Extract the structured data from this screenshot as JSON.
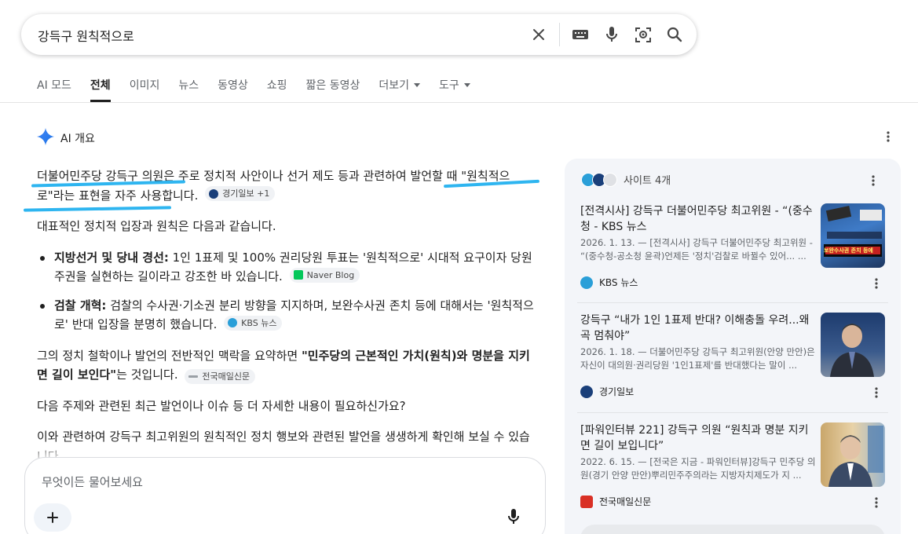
{
  "search": {
    "query": "강득구 원칙적으로"
  },
  "tabs": [
    {
      "label": "AI 모드"
    },
    {
      "label": "전체",
      "active": true
    },
    {
      "label": "이미지"
    },
    {
      "label": "뉴스"
    },
    {
      "label": "동영상"
    },
    {
      "label": "쇼핑"
    },
    {
      "label": "짧은 동영상"
    },
    {
      "label": "더보기",
      "dropdown": true
    },
    {
      "label": "도구",
      "dropdown": true
    }
  ],
  "ai_overview": {
    "heading": "AI 개요",
    "intro": "더불어민주당 강득구 의원은 주로 정치적 사안이나 선거 제도 등과 관련하여 발언할 때 \"원칙적으로\"라는 표현을 자주 사용합니다.",
    "intro_chip": "경기일보 +1",
    "summary": "대표적인 정치적 입장과 원칙은 다음과 같습니다.",
    "bullets": [
      {
        "bold": "지방선거 및 당내 경선:",
        "text": " 1인 1표제 및 100% 권리당원 투표는 '원칙적으로' 시대적 요구이자 당원 주권을 실현하는 길이라고 강조한 바 있습니다.",
        "chip": "Naver Blog"
      },
      {
        "bold": "검찰 개혁:",
        "text": " 검찰의 수사권·기소권 분리 방향을 지지하며, 보완수사권 존치 등에 대해서는 '원칙적으로' 반대 입장을 분명히 했습니다.",
        "chip": "KBS 뉴스"
      }
    ],
    "philosophy_pre": "그의 정치 철학이나 발언의 전반적인 맥락을 요약하면 ",
    "philosophy_bold": "\"민주당의 근본적인 가치(원칙)와 명분을 지키면 길이 보인다\"",
    "philosophy_post": "는 것입니다.",
    "philosophy_chip": "전국매일신문",
    "question": "다음 주제와 관련된 최근 발언이나 이슈 등 더 자세한 내용이 필요하신가요?",
    "closing": "이와 관련하여 강득구 최고위원의 원칙적인 정치 행보와 관련된 발언을 생생하게 확인해 보실 수 있습니다."
  },
  "ask": {
    "placeholder": "무엇이든 물어보세요"
  },
  "sources": {
    "heading": "사이트 4개",
    "cards": [
      {
        "title": "[전격시사] 강득구 더불어민주당 최고위원 - “(중수청 - KBS 뉴스",
        "snippet": "2026. 1. 13. — [전격시사] 강득구 더불어민주당 최고위원 - “(중수청-공소청 윤곽)언제든 '정치'검찰로 바뀔수 있어... ...",
        "source": "KBS 뉴스",
        "thumb_text": "보완수사권 존치 등에"
      },
      {
        "title": "강득구 “내가 1인 1표제 반대? 이해충돌 우려...왜곡 멈춰야”",
        "snippet": "2026. 1. 18. — 더불어민주당 강득구 최고위원(안양 만안)은 자신이 대의원·권리당원 '1인1표제'를 반대했다는 말이 ...",
        "source": "경기일보"
      },
      {
        "title": "[파워인터뷰 221] 강득구 의원 “원칙과 명분 지키면 길이 보입니다”",
        "snippet": "2022. 6. 15. — [전국은 지금 - 파워인터뷰]강득구 민주당 의원(경기 안양 만안)뿌리민주주의라는 지방자치제도가 지 ...",
        "source": "전국매일신문"
      }
    ]
  },
  "colors": {
    "accent": "#1a73e8",
    "highlight": "#2eb5f0",
    "panel_bg": "#f3f5f9"
  }
}
